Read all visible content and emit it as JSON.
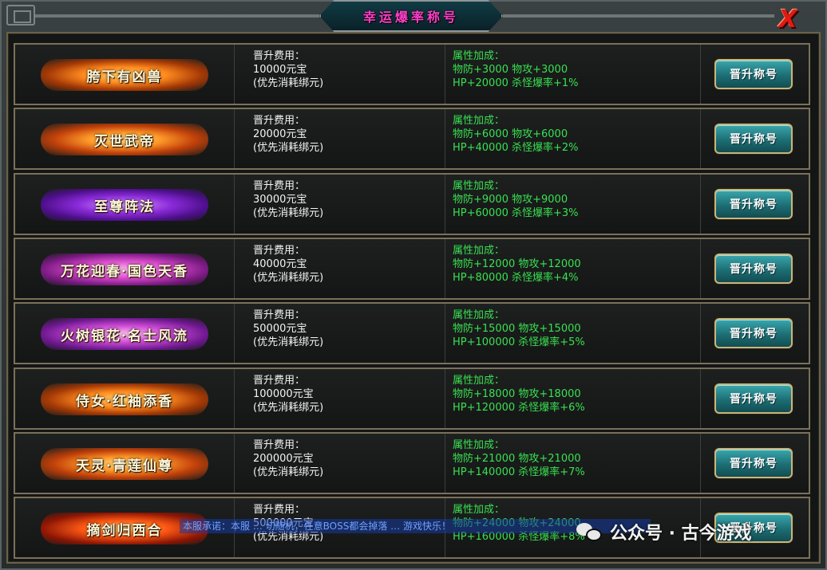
{
  "window": {
    "title": "幸运爆率称号",
    "close_glyph": "X"
  },
  "labels": {
    "cost_label": "晋升费用：",
    "cost_note": "(优先消耗绑元)",
    "attr_label": "属性加成：",
    "button_label": "晋升称号"
  },
  "titles": [
    {
      "name": "胯下有凶兽",
      "cost": "10000元宝",
      "attr_line1": "物防+3000 物攻+3000",
      "attr_line2": "HP+20000 杀怪爆率+1%",
      "style": "fire"
    },
    {
      "name": "灭世武帝",
      "cost": "20000元宝",
      "attr_line1": "物防+6000 物攻+6000",
      "attr_line2": "HP+40000 杀怪爆率+2%",
      "style": "fire2"
    },
    {
      "name": "至尊阵法",
      "cost": "30000元宝",
      "attr_line1": "物防+9000 物攻+9000",
      "attr_line2": "HP+60000 杀怪爆率+3%",
      "style": "purple"
    },
    {
      "name": "万花迎春·国色天香",
      "cost": "40000元宝",
      "attr_line1": "物防+12000 物攻+12000",
      "attr_line2": "HP+80000 杀怪爆率+4%",
      "style": "pink"
    },
    {
      "name": "火树银花·名士风流",
      "cost": "50000元宝",
      "attr_line1": "物防+15000 物攻+15000",
      "attr_line2": "HP+100000 杀怪爆率+5%",
      "style": "magenta"
    },
    {
      "name": "侍女·红袖添香",
      "cost": "100000元宝",
      "attr_line1": "物防+18000 物攻+18000",
      "attr_line2": "HP+120000 杀怪爆率+6%",
      "style": "fire"
    },
    {
      "name": "天灵·青莲仙尊",
      "cost": "200000元宝",
      "attr_line1": "物防+21000 物攻+21000",
      "attr_line2": "HP+140000 杀怪爆率+7%",
      "style": "fire2"
    },
    {
      "name": "摘剑归西合",
      "cost": "500000元宝",
      "attr_line1": "物防+24000 物攻+24000",
      "attr_line2": "HP+160000 杀怪爆率+8%",
      "style": "red"
    }
  ],
  "background_bleed": {
    "notice": "本服承诺：本服 … 切随机，任意BOSS都会掉落 … 游戏快乐！"
  },
  "watermark": {
    "text": "公众号 · 古今游戏",
    "icon": "wechat-icon"
  },
  "colors": {
    "title_text": "#ff3fc8",
    "attr_text": "#39e051",
    "button_fill": "#1c6e74",
    "close_red": "#e01b12"
  }
}
